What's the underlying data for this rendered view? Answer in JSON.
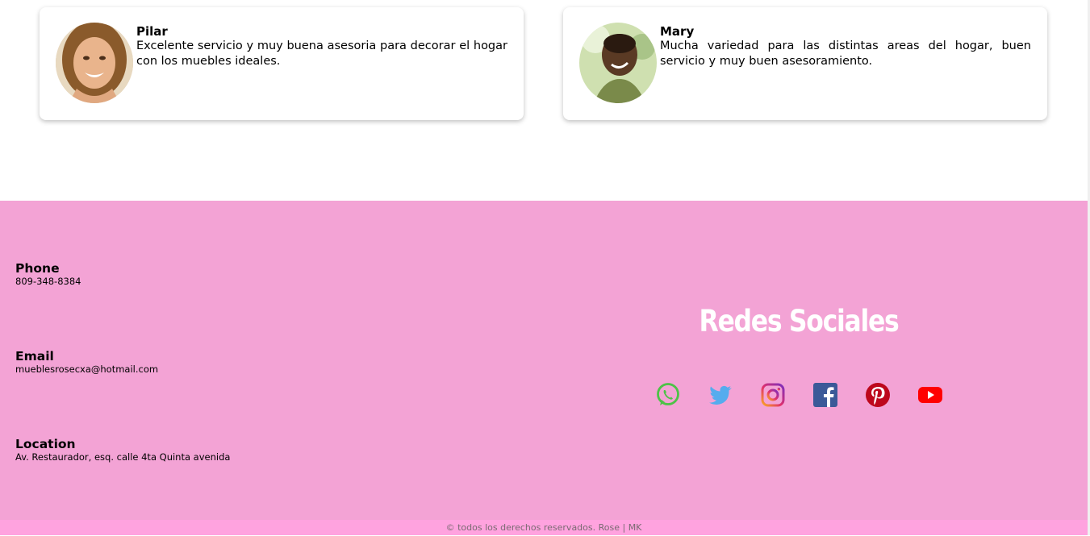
{
  "testimonials": [
    {
      "name": "Pilar",
      "quote": "Excelente servicio y muy buena asesoria para decorar el hogar con los muebles ideales."
    },
    {
      "name": "Mary",
      "quote": "Mucha variedad para las distintas areas del hogar, buen servicio y muy buen asesoramiento."
    }
  ],
  "footer": {
    "contact": [
      {
        "title": "Phone",
        "value": "809-348-8384"
      },
      {
        "title": "Email",
        "value": "mueblesrosecxa@hotmail.com"
      },
      {
        "title": "Location",
        "value": "Av. Restaurador, esq. calle 4ta Quinta avenida"
      }
    ],
    "social_title": "Redes Sociales",
    "social_icons": [
      "whatsapp-icon",
      "twitter-icon",
      "instagram-icon",
      "facebook-icon",
      "pinterest-icon",
      "youtube-icon"
    ],
    "copyright": "© todos los derechos reservados. Rose | MK",
    "colors": {
      "footer_bg": "#f3a3d5",
      "copyright_bg": "#ffa3df",
      "whatsapp": "#4dc247",
      "twitter": "#55acee",
      "facebook": "#3b5998",
      "pinterest": "#bd081c",
      "youtube": "#ff0000"
    }
  }
}
